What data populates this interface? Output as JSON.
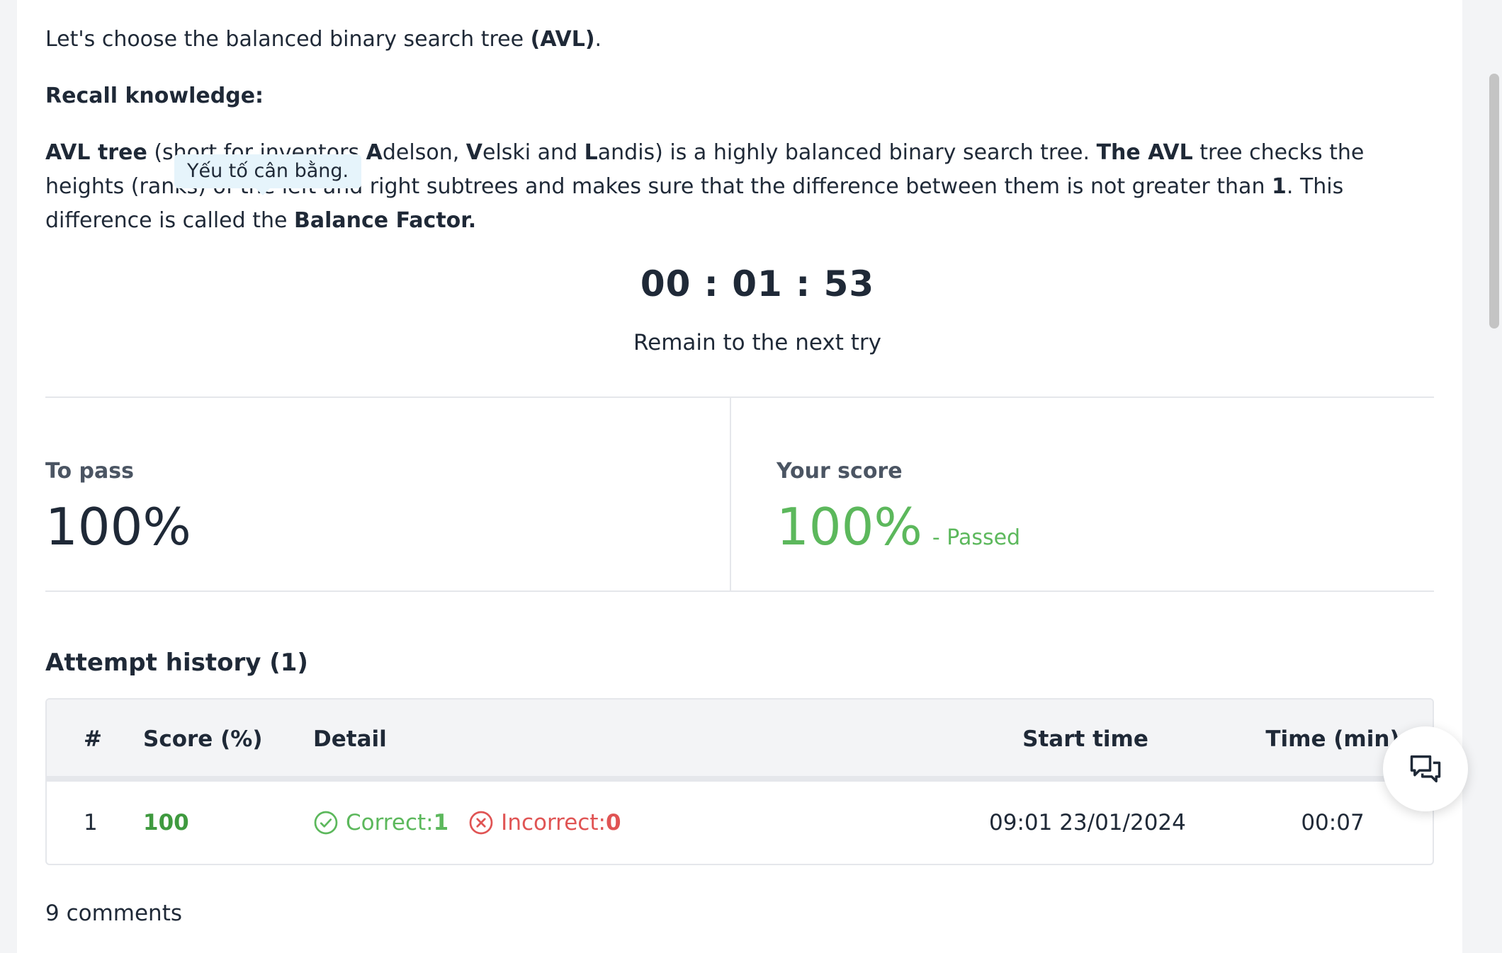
{
  "content": {
    "intro_text": "Let's choose the balanced binary search tree ",
    "intro_bold": "(AVL)",
    "intro_end": ".",
    "recall_heading": "Recall knowledge:",
    "avl": {
      "s1": "AVL tree",
      "s2": " (short for inventors ",
      "a": "A",
      "s3": "delson, ",
      "v": "V",
      "s4": "elski and ",
      "l": "L",
      "s5": "andis) is a highly balanced binary search tree. ",
      "the_avl": "The AVL",
      "s6": " tree checks the heights (ranks) of the left and right subtrees and makes sure that the difference between them is not greater than ",
      "one": "1",
      "s7": ". This difference is called the ",
      "balance_factor": "Balance Factor."
    },
    "tooltip": "Yếu tố cân bằng."
  },
  "timer": {
    "value": "00 : 01 : 53",
    "label": "Remain to the next try"
  },
  "scores": {
    "to_pass_label": "To pass",
    "to_pass_value": "100%",
    "your_score_label": "Your score",
    "your_score_value": "100%",
    "status": "- Passed"
  },
  "history": {
    "title": "Attempt history (1)",
    "columns": [
      "#",
      "Score (%)",
      "Detail",
      "Start time",
      "Time (min)"
    ],
    "rows": [
      {
        "num": "1",
        "score": "100",
        "correct_label": "Correct: ",
        "correct_value": "1",
        "incorrect_label": "Incorrect: ",
        "incorrect_value": "0",
        "start_time": "09:01 23/01/2024",
        "time": "00:07"
      }
    ]
  },
  "comments": {
    "count_label": "9 comments"
  },
  "icons": {
    "chat": "chat-bubbles-icon",
    "correct": "check-circle-icon",
    "incorrect": "x-circle-icon"
  },
  "colors": {
    "pass_green": "#5cb85c",
    "score_green": "#3f9a3f",
    "error_red": "#e05454"
  }
}
